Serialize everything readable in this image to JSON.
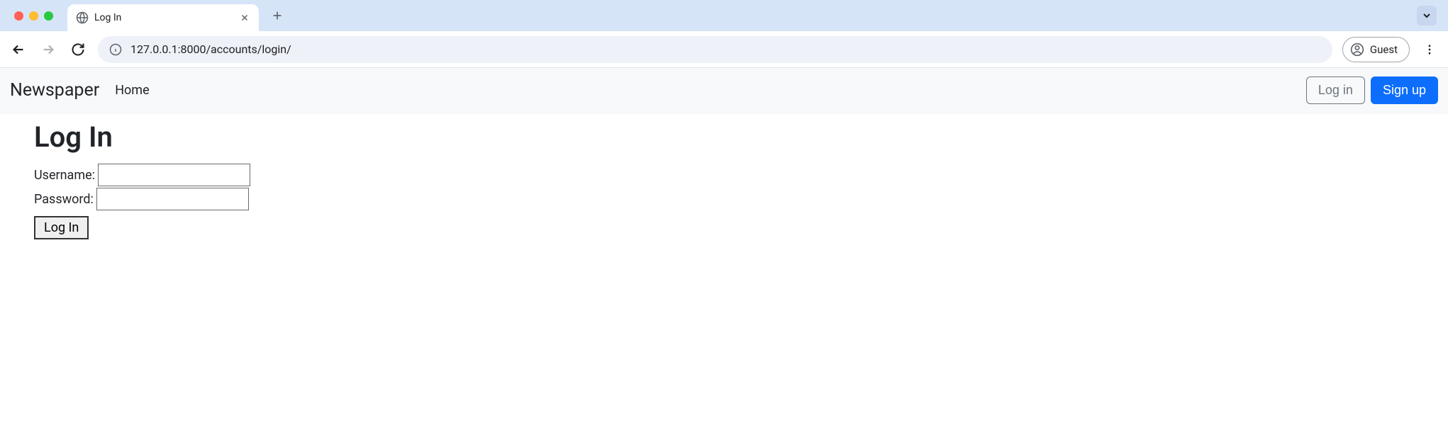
{
  "browser": {
    "tab_title": "Log In",
    "url": "127.0.0.1:8000/accounts/login/",
    "profile_label": "Guest"
  },
  "navbar": {
    "brand": "Newspaper",
    "home_link": "Home",
    "login_btn": "Log in",
    "signup_btn": "Sign up"
  },
  "page": {
    "heading": "Log In",
    "username_label": "Username:",
    "password_label": "Password:",
    "submit_label": "Log In"
  }
}
